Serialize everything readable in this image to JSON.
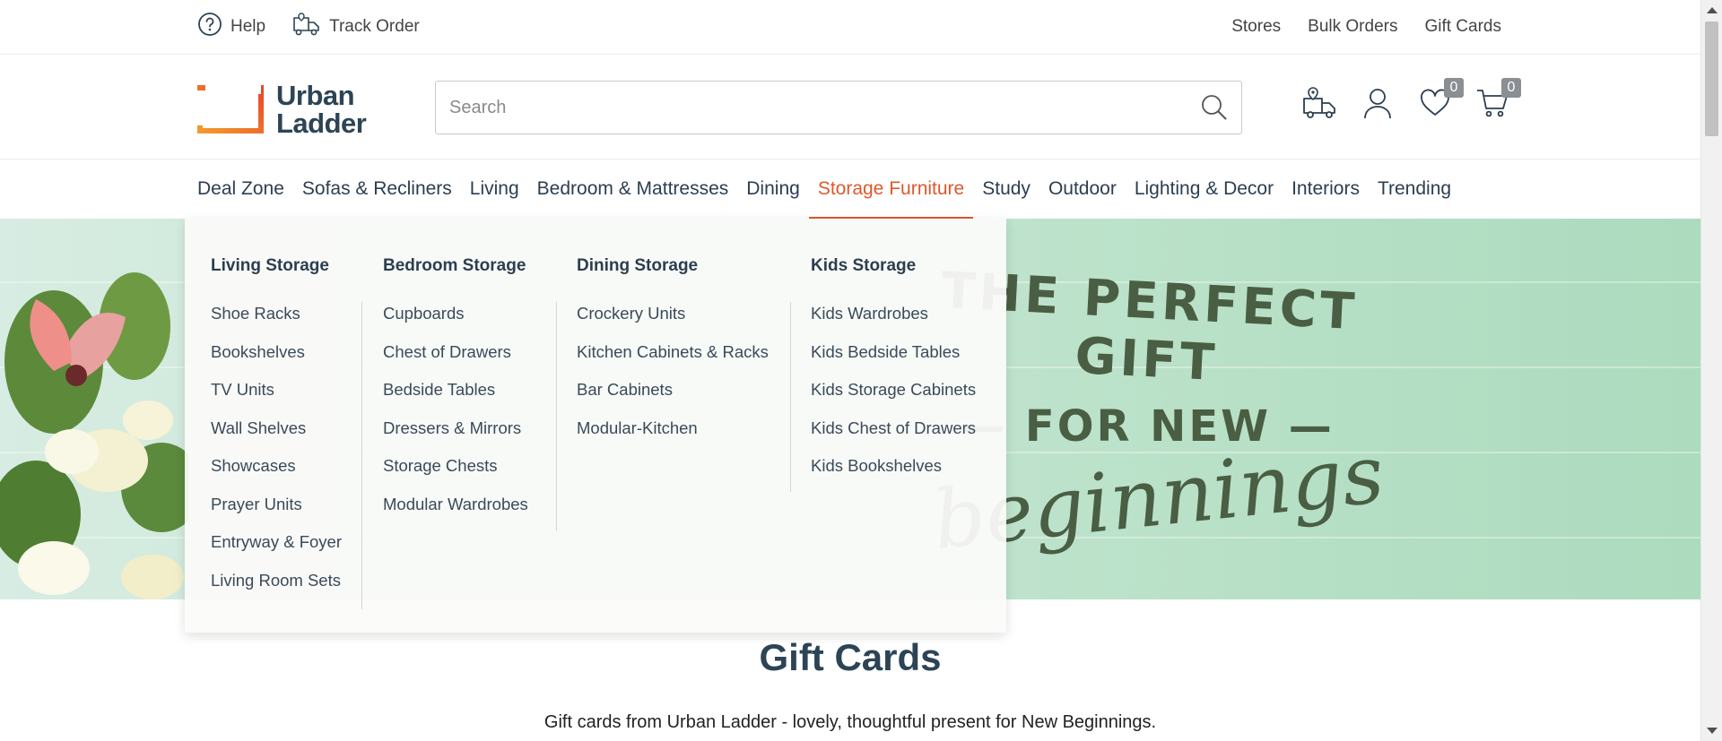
{
  "topbar": {
    "help_label": "Help",
    "track_order_label": "Track Order",
    "links": [
      "Stores",
      "Bulk Orders",
      "Gift Cards"
    ]
  },
  "header": {
    "logo_line1": "Urban",
    "logo_line2": "Ladder",
    "search_placeholder": "Search",
    "wishlist_count": "0",
    "cart_count": "0"
  },
  "nav": {
    "items": [
      "Deal Zone",
      "Sofas & Recliners",
      "Living",
      "Bedroom & Mattresses",
      "Dining",
      "Storage Furniture",
      "Study",
      "Outdoor",
      "Lighting & Decor",
      "Interiors",
      "Trending"
    ],
    "active": "Storage Furniture"
  },
  "mega_menu": {
    "columns": [
      {
        "title": "Living Storage",
        "items": [
          "Shoe Racks",
          "Bookshelves",
          "TV Units",
          "Wall Shelves",
          "Showcases",
          "Prayer Units",
          "Entryway & Foyer",
          "Living Room Sets"
        ]
      },
      {
        "title": "Bedroom Storage",
        "items": [
          "Cupboards",
          "Chest of Drawers",
          "Bedside Tables",
          "Dressers & Mirrors",
          "Storage Chests",
          "Modular Wardrobes"
        ]
      },
      {
        "title": "Dining Storage",
        "items": [
          "Crockery Units",
          "Kitchen Cabinets & Racks",
          "Bar Cabinets",
          "Modular-Kitchen"
        ]
      },
      {
        "title": "Kids Storage",
        "items": [
          "Kids Wardrobes",
          "Kids Bedside Tables",
          "Kids Storage Cabinets",
          "Kids Chest of Drawers",
          "Kids Bookshelves"
        ]
      }
    ]
  },
  "hero": {
    "line1": "THE PERFECT GIFT",
    "line2": "— FOR NEW —",
    "line3": "beginnings"
  },
  "gift_cards": {
    "title": "Gift Cards",
    "description": "Gift cards from Urban Ladder - lovely, thoughtful present for New Beginnings."
  },
  "colors": {
    "accent": "#e0582c",
    "brand_dark": "#2c4455",
    "badge": "#8a8f94"
  }
}
